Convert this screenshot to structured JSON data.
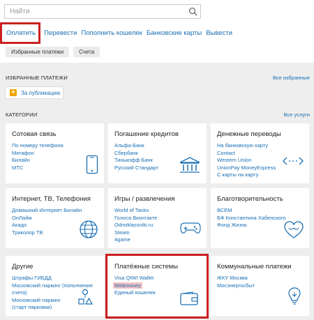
{
  "search": {
    "placeholder": "Найти",
    "icon": "search-icon"
  },
  "tabs": [
    {
      "label": "Оплатить"
    },
    {
      "label": "Перевести"
    },
    {
      "label": "Пополнить кошелек"
    },
    {
      "label": "Банковские карты"
    },
    {
      "label": "Вывести"
    }
  ],
  "chips": [
    {
      "label": "Избранные платежи"
    },
    {
      "label": "Счета"
    }
  ],
  "favorites": {
    "title": "ИЗБРАННЫЕ ПЛАТЕЖИ",
    "all_link": "Все избранные",
    "item": {
      "label": "За публикацию",
      "icon": "star-icon",
      "icon_color": "#f0a500"
    }
  },
  "categories": {
    "title": "КАТЕГОРИИ",
    "all_link": "Все услуги",
    "cards": [
      {
        "title": "Сотовая связь",
        "links": [
          "По номеру телефона",
          "Мегафон",
          "Билайн",
          "МТС"
        ],
        "icon": "phone-icon"
      },
      {
        "title": "Погашение кредитов",
        "links": [
          "Альфа-Банк",
          "Сбербанк",
          "Тинькофф Банк",
          "Русский Стандарт"
        ],
        "icon": "bank-icon"
      },
      {
        "title": "Денежные переводы",
        "links": [
          "На банковскую карту",
          "Contact",
          "Western Union",
          "UnionPay MoneyExpress",
          "С карты на карту"
        ],
        "icon": "transfer-icon"
      },
      {
        "title": "Интернет, ТВ, Телефония",
        "links": [
          "Домашний Интернет Билайн",
          "ОнЛайм",
          "Акадо",
          "Триколор ТВ"
        ],
        "icon": "globe-icon"
      },
      {
        "title": "Игры / развлечения",
        "links": [
          "World of Tanks",
          "Голоса Вконтакте",
          "Odnoklassniki.ru",
          "Steam",
          "4game"
        ],
        "icon": "gamepad-icon"
      },
      {
        "title": "Благотворительность",
        "links": [
          "ВСЕМ",
          "БФ Константина Хабенского",
          "Фонд Жизнь"
        ],
        "icon": "heart-icon"
      },
      {
        "title": "Другие",
        "links": [
          "Штрафы ГИБДД",
          "Московский паркинг (пополнение",
          "счета)",
          "Московский паркинг",
          "(старт парковки)"
        ],
        "icon": "misc-icon"
      },
      {
        "title": "Платёжные системы",
        "links": [
          "Visa QIWI Wallet",
          "Webmoney",
          "Единый кошелек"
        ],
        "icon": "wallet-icon"
      },
      {
        "title": "Коммунальные платежи",
        "links": [
          "ЖКУ Москва",
          "Мосэнергосбыт"
        ],
        "icon": "bulb-icon"
      }
    ]
  },
  "colors": {
    "accent": "#1a6fb3",
    "highlight_frame": "#cc1f1f",
    "highlight_fill": "#f4c2c4",
    "background": "#eeeeee"
  }
}
